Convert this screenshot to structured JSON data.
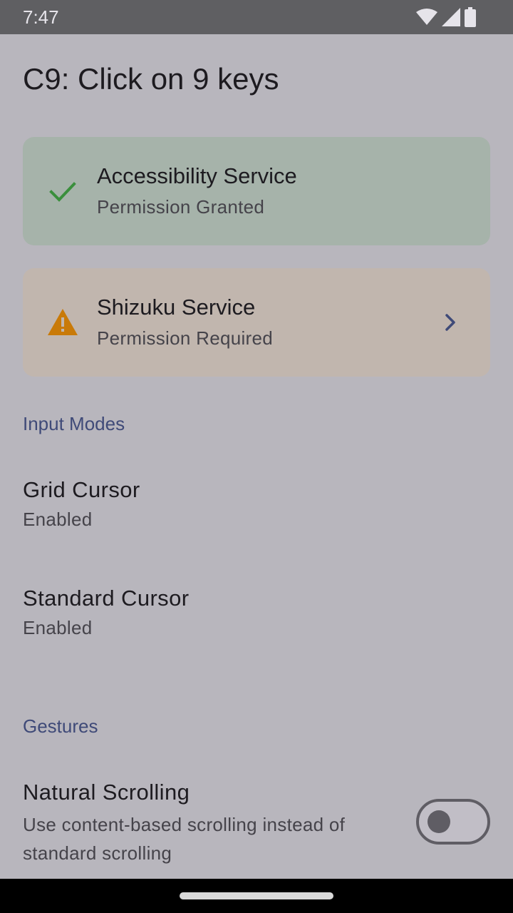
{
  "status_bar": {
    "time": "7:47",
    "icons": [
      "wifi-icon",
      "cellular-signal-icon",
      "battery-icon"
    ]
  },
  "page": {
    "title": "C9: Click on 9 keys"
  },
  "cards": {
    "accessibility": {
      "title": "Accessibility Service",
      "status": "Permission Granted",
      "icon": "check-icon",
      "color": "#a6b3aa",
      "icon_color": "#3a8f3c"
    },
    "shizuku": {
      "title": "Shizuku Service",
      "status": "Permission Required",
      "icon": "warning-icon",
      "color": "#c1b6ae",
      "icon_color": "#c97a08",
      "action_icon": "chevron-right-icon"
    }
  },
  "sections": {
    "input_modes": {
      "header": "Input Modes",
      "items": [
        {
          "title": "Grid Cursor",
          "subtitle": "Enabled"
        },
        {
          "title": "Standard Cursor",
          "subtitle": "Enabled"
        }
      ]
    },
    "gestures": {
      "header": "Gestures",
      "items": [
        {
          "title": "Natural Scrolling",
          "description": "Use content-based scrolling instead of standard scrolling",
          "toggle_on": false
        }
      ]
    }
  },
  "colors": {
    "background": "#b8b6bd",
    "accent": "#3f4a78",
    "status_bar": "#5f5f62",
    "nav_bar": "#000000"
  }
}
